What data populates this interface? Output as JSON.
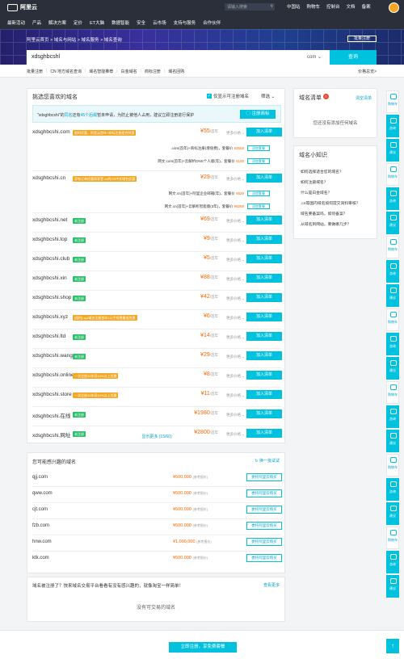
{
  "topbar": {
    "brand": "阿里云",
    "search_placeholder": "请输入搜索",
    "right_links": [
      "中国站",
      "购物车",
      "控制台",
      "文档",
      "备案"
    ],
    "nav": [
      "最新活动",
      "产品",
      "解决方案",
      "定价",
      "ET大脑",
      "数据智能",
      "安全",
      "云市场",
      "支持与服务",
      "合作伙伴"
    ]
  },
  "hero": {
    "breadcrumb": "阿里云首页 > 域名与网站 > 域名服务 > 域名查询",
    "bulk_label": "批量注册",
    "query_value": "xdsghbcshl",
    "suffix": "com",
    "query_button": "查询"
  },
  "subbar": {
    "links": [
      "批量注册",
      "CN 地方域名查询",
      "域名智能推荐",
      "白金域名",
      "商标注册",
      "域名回购"
    ],
    "price_link": "价格总览>"
  },
  "main": {
    "title": "挑选您喜欢的域名",
    "only_unregistered": "仅显示可注册域名",
    "filter": "筛选",
    "notice": {
      "prefix": "\"xdsghbcshi\"的",
      "hl1": "同名",
      "mid": "还有",
      "hl2": "45个后缀",
      "suffix": "暂未申请，为防止被他人占用，建议立即注册进行保护",
      "button": "注册商标"
    },
    "more_label": "更多价格",
    "add_label": "加入清单",
    "rows": [
      {
        "domain": "xdsghbcshi.com",
        "tag": "限时优惠，阿里云首年+商标注册组合特惠",
        "tag_color": "#f5a623",
        "price": "¥55",
        "unit": "首年"
      },
      {
        "domain": "xdsghbcshi.cn",
        "tag": "享有订单优惠再享受.cn的CN中文域名优惠",
        "tag_color": "#f5a623",
        "price": "¥29",
        "unit": "首年"
      },
      {
        "domain": "xdsghbcshi.net",
        "tag": "未注册",
        "tag_color": "#2dbe6c",
        "price": "¥69",
        "unit": "首年"
      },
      {
        "domain": "xdsghbcshi.top",
        "tag": "未注册",
        "tag_color": "#2dbe6c",
        "price": "¥9",
        "unit": "首年"
      },
      {
        "domain": "xdsghbcshi.club",
        "tag": "未注册",
        "tag_color": "#2dbe6c",
        "price": "¥5",
        "unit": "首年"
      },
      {
        "domain": "xdsghbcshi.xin",
        "tag": "未注册",
        "tag_color": "#2dbe6c",
        "price": "¥88",
        "unit": "首年"
      },
      {
        "domain": "xdsghbcshi.shop",
        "tag": "未注册",
        "tag_color": "#2dbe6c",
        "price": "¥42",
        "unit": "首年"
      },
      {
        "domain": "xdsghbcshi.xyz",
        "tag": "[限时].xyz域名注册首年1元手续费最低优惠",
        "tag_color": "#f5a623",
        "price": "¥6",
        "unit": "首年"
      },
      {
        "domain": "xdsghbcshi.ltd",
        "tag": "未注册",
        "tag_color": "#2dbe6c",
        "price": "¥14",
        "unit": "首年"
      },
      {
        "domain": "xdsghbcshi.wang",
        "tag": "未注册",
        "tag_color": "#2dbe6c",
        "price": "¥29",
        "unit": "首年"
      },
      {
        "domain": "xdsghbcshi.online",
        "tag": "一次注册10年获10%以上优惠",
        "tag_color": "#f5a623",
        "price": "¥8",
        "unit": "首年"
      },
      {
        "domain": "xdsghbcshi.store",
        "tag": "一次注册10年获10%以上优惠",
        "tag_color": "#f5a623",
        "price": "¥11",
        "unit": "首年"
      },
      {
        "domain": "xdsghbcshi.在线",
        "tag": "未注册",
        "tag_color": "#2dbe6c",
        "price": "¥1980",
        "unit": "首年"
      },
      {
        "domain": "xdsghbcshi.网址",
        "tag": "未注册",
        "tag_color": "#2dbe6c",
        "price": "¥2800",
        "unit": "首年"
      }
    ],
    "combos": [
      {
        "text": ".com(首年)+商标注册(增值费)，套餐价",
        "price": "¥3558",
        "button": "添加套餐"
      },
      {
        "text": "网文.com(首年)+云解析DNS个人版(年)，套餐价",
        "price": "¥100",
        "button": "添加套餐"
      },
      {
        "text": "网文.cn(首年)+阿里企业邮箱(年)，套餐价",
        "price": "¥629",
        "button": "添加套餐"
      },
      {
        "text": "网文.cn(首年)+云解析智能版(3年)，套餐价",
        "price": "¥6268",
        "button": "添加套餐"
      }
    ],
    "show_more": "显示更多 (15/60)"
  },
  "like": {
    "title": "您可能感兴趣的域名",
    "refresh": "换一批试试",
    "ref_label": "参考报价",
    "button": "委托阿里云购买",
    "rows": [
      {
        "domain": "qjj.com",
        "price": "¥600,000"
      },
      {
        "domain": "qww.com",
        "price": "¥600,000"
      },
      {
        "domain": "cjt.com",
        "price": "¥600,000"
      },
      {
        "domain": "fzb.com",
        "price": "¥600,000"
      },
      {
        "domain": "hnw.com",
        "price": "¥1,000,000"
      },
      {
        "domain": "ktk.com",
        "price": "¥600,000"
      }
    ]
  },
  "trade": {
    "title": "域名被注册了？快来域名交易平台看看有没有感兴趣的，就像淘宝一样简单！",
    "link": "查看更多",
    "empty": "没有可交易的域名"
  },
  "cart": {
    "title": "域名清单",
    "count": "0",
    "clear": "清空清单",
    "empty": "您还没有添加任何域名"
  },
  "tips": {
    "title": "域名小知识",
    "items": [
      "如何选择适合您的域名？",
      "如何注册域名？",
      "什么是白金域名？",
      ".cn等国内域名如何提交资料审核？",
      "域名要备案吗，如何备案？",
      "从域名到网站，要做哪几步？"
    ]
  },
  "rail": [
    {
      "label": "购物车",
      "cyan": false
    },
    {
      "label": "咨询",
      "cyan": true
    },
    {
      "label": "建议",
      "cyan": true
    },
    {
      "label": "购物车",
      "cyan": false
    },
    {
      "label": "咨询",
      "cyan": true
    },
    {
      "label": "建议",
      "cyan": true
    },
    {
      "label": "购物车",
      "cyan": false
    },
    {
      "label": "咨询",
      "cyan": true
    },
    {
      "label": "建议",
      "cyan": true
    },
    {
      "label": "购物车",
      "cyan": false
    },
    {
      "label": "咨询",
      "cyan": true
    },
    {
      "label": "建议",
      "cyan": true
    },
    {
      "label": "购物车",
      "cyan": false
    },
    {
      "label": "咨询",
      "cyan": true
    },
    {
      "label": "建议",
      "cyan": true
    },
    {
      "label": "购物车",
      "cyan": false
    },
    {
      "label": "咨询",
      "cyan": true
    },
    {
      "label": "建议",
      "cyan": true
    },
    {
      "label": "购物车",
      "cyan": false
    },
    {
      "label": "咨询",
      "cyan": true
    },
    {
      "label": "建议",
      "cyan": true
    }
  ],
  "bottom": {
    "cta": "立即注册，享免费套餐",
    "top_icon": "arrow-up-icon"
  }
}
